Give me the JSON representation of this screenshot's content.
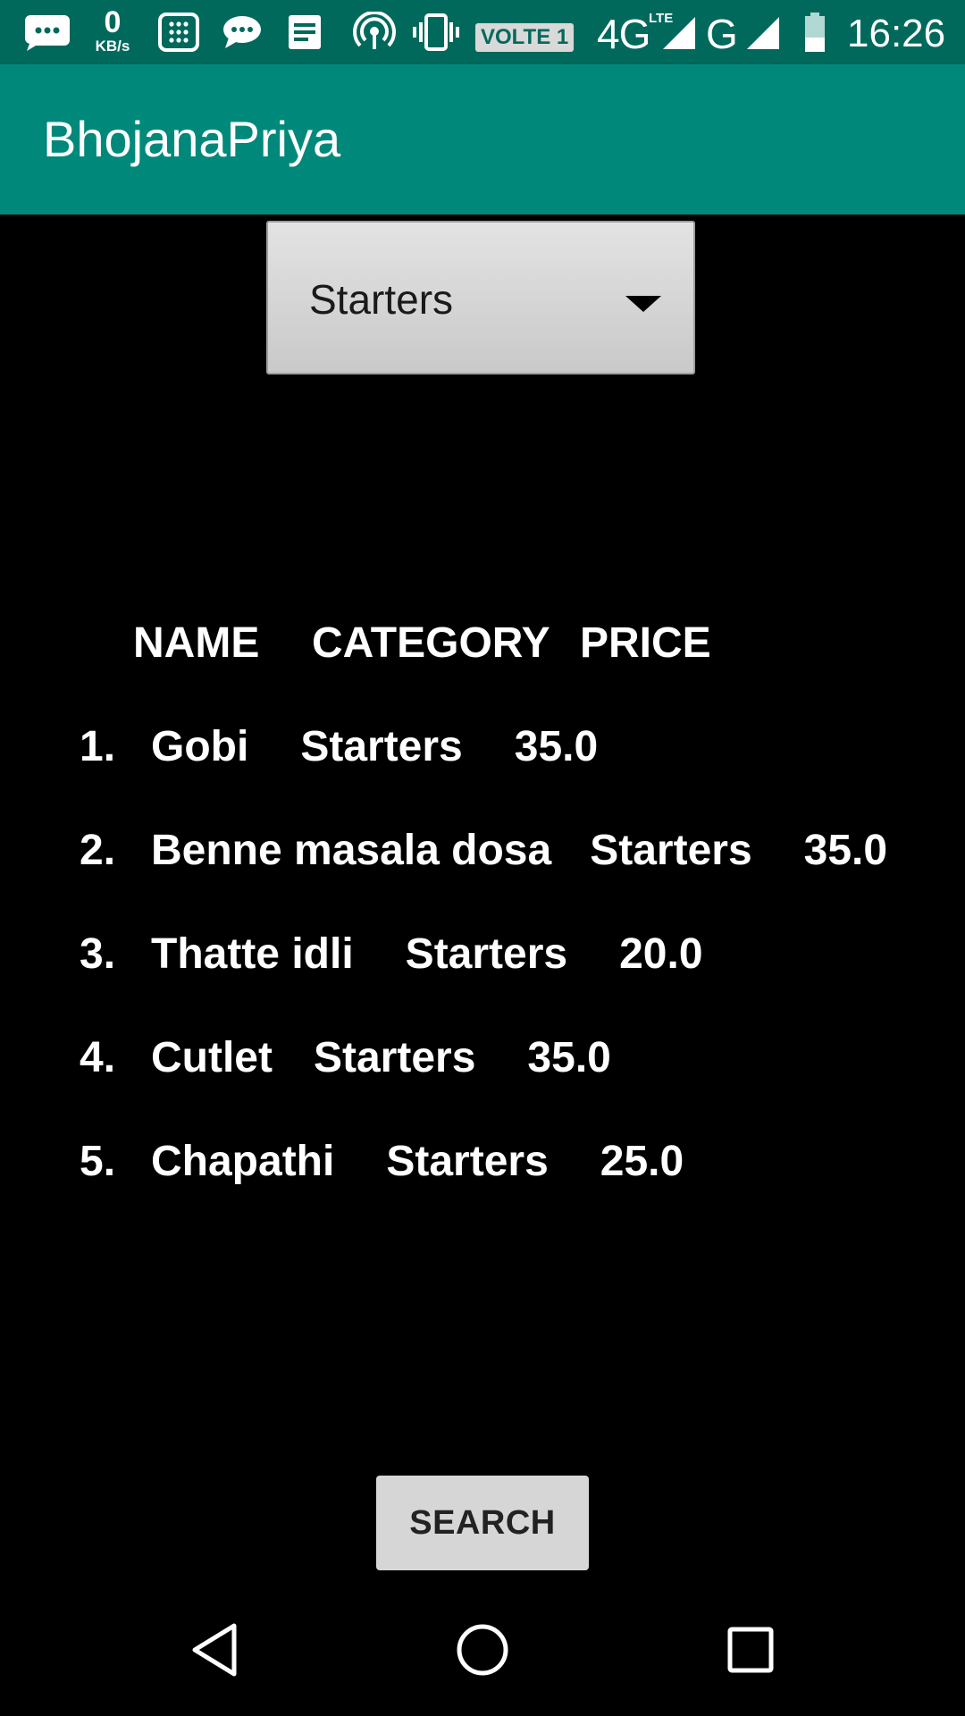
{
  "status_bar": {
    "data_speed_value": "0",
    "data_speed_unit": "KB/s",
    "volte_label": "VOLTE 1",
    "network_primary": "4G",
    "network_primary_sub": "LTE",
    "network_secondary": "G",
    "time": "16:26",
    "icons": [
      "chat-bubble-icon",
      "keypad-icon",
      "message-icon",
      "notes-icon",
      "hotspot-icon",
      "vibrate-icon",
      "signal-icon",
      "battery-icon"
    ]
  },
  "app_bar": {
    "title": "BhojanaPriya"
  },
  "category_spinner": {
    "selected": "Starters"
  },
  "table": {
    "headers": {
      "name": "NAME",
      "category": "CATEGORY",
      "price": "PRICE"
    },
    "rows": [
      {
        "index": "1.",
        "name": "Gobi",
        "category": "Starters",
        "price": "35.0"
      },
      {
        "index": "2.",
        "name": "Benne masala dosa",
        "category": "Starters",
        "price": "35.0"
      },
      {
        "index": "3.",
        "name": "Thatte idli",
        "category": "Starters",
        "price": "20.0"
      },
      {
        "index": "4.",
        "name": "Cutlet",
        "category": "Starters",
        "price": "35.0"
      },
      {
        "index": "5.",
        "name": "Chapathi",
        "category": "Starters",
        "price": "25.0"
      }
    ]
  },
  "search_button": {
    "label": "SEARCH"
  },
  "nav_bar": {
    "icons": [
      "back-icon",
      "home-icon",
      "recents-icon"
    ]
  },
  "colors": {
    "status_bar": "#00695c",
    "app_bar": "#00897b",
    "background": "#000000",
    "text": "#ffffff",
    "button": "#d6d6d6"
  }
}
